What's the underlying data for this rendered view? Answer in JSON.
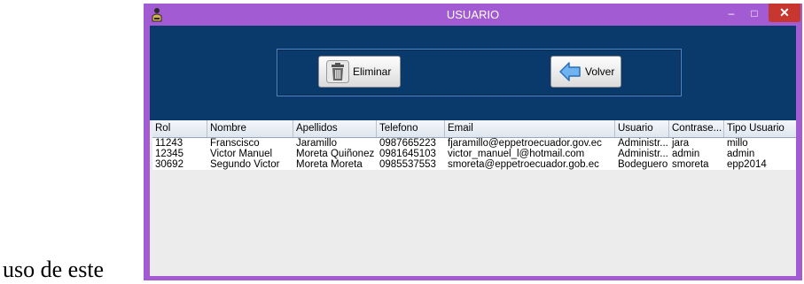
{
  "caption": "uso de este",
  "window": {
    "title": "USUARIO",
    "controls": {
      "minimize": "–",
      "maximize": "□",
      "close": "✕"
    }
  },
  "toolbar": {
    "eliminar_label": "Eliminar",
    "volver_label": "Volver"
  },
  "table": {
    "columns": [
      "Rol",
      "Nombre",
      "Apellidos",
      "Telefono",
      "Email",
      "Usuario",
      "Contrase...",
      "Tipo Usuario"
    ],
    "rows": [
      [
        "11243",
        "Franscisco",
        "Jaramillo",
        "0987665223",
        "fjaramillo@eppetroecuador.gov.ec",
        "Administr...",
        "jara",
        "millo"
      ],
      [
        "12345",
        "Victor Manuel",
        "Moreta Quiñonez",
        "0981645103",
        "victor_manuel_l@hotmail.com",
        "Administr...",
        "admin",
        "admin"
      ],
      [
        "30692",
        "Segundo Victor",
        "Moreta Moreta",
        "0985537553",
        "smoreta@eppetroecuador.gob.ec",
        "Bodeguero",
        "smoreta",
        "epp2014"
      ]
    ]
  },
  "colors": {
    "frame": "#a35bd4",
    "content_bg": "#0a3a6b",
    "close_button": "#c7372f"
  },
  "icons": {
    "app": "user-icon",
    "eliminar": "trash-icon",
    "volver": "arrow-left-icon"
  }
}
